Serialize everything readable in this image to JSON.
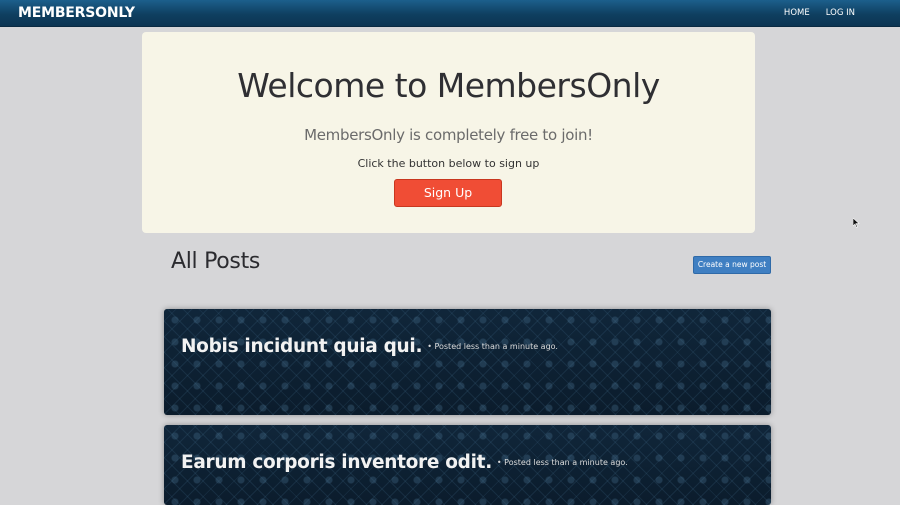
{
  "navbar": {
    "brand": "MEMBERSONLY",
    "links": [
      {
        "label": "HOME"
      },
      {
        "label": "LOG IN"
      }
    ]
  },
  "jumbotron": {
    "title": "Welcome to MembersOnly",
    "lead": "MembersOnly is completely free to join!",
    "note": "Click the button below to sign up",
    "signup_label": "Sign Up"
  },
  "posts_section": {
    "heading": "All Posts",
    "create_label": "Create a new post"
  },
  "posts": [
    {
      "title": "Nobis incidunt quia qui.",
      "meta": "• Posted less than a minute ago."
    },
    {
      "title": "Earum corporis inventore odit.",
      "meta": "• Posted less than a minute ago."
    }
  ],
  "colors": {
    "navbar": "#0f3f60",
    "jumbotron_bg": "#f7f5e7",
    "signup_button": "#f04d35",
    "create_button": "#3f7fc2",
    "post_card_bg": "#0f2538",
    "page_bg": "#d6d6d8"
  },
  "icons": {
    "cursor": "mouse-pointer-icon"
  }
}
